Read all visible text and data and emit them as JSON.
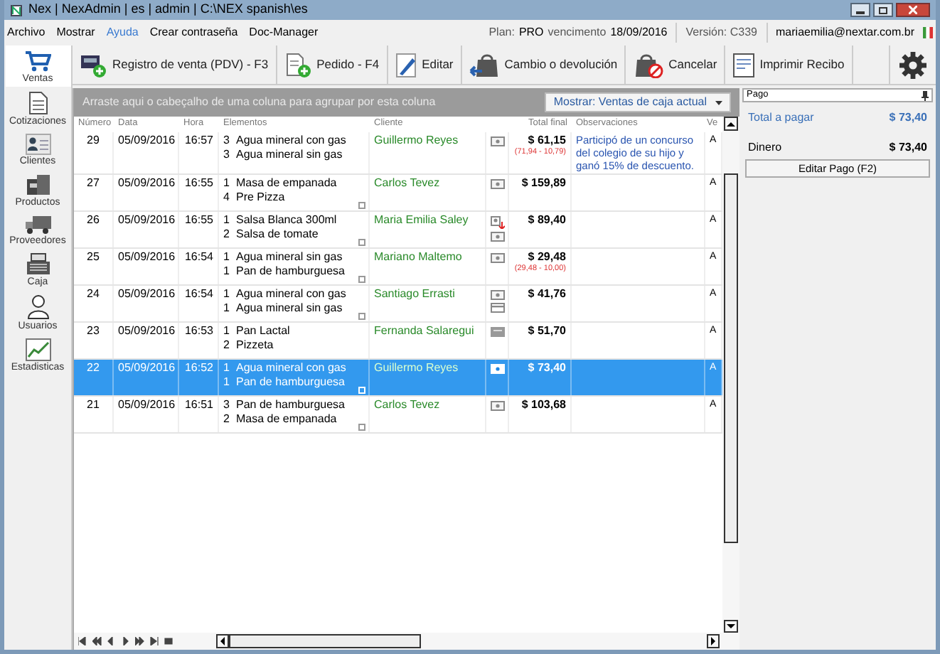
{
  "window": {
    "title": "Nex | NexAdmin | es | admin | C:\\NEX spanish\\es"
  },
  "menu": [
    {
      "label": "Archivo",
      "highlighted": false
    },
    {
      "label": "Mostrar",
      "highlighted": false
    },
    {
      "label": "Ayuda",
      "highlighted": true
    },
    {
      "label": "Crear contraseña",
      "highlighted": false
    },
    {
      "label": "Doc-Manager",
      "highlighted": false
    }
  ],
  "account": {
    "plan_label": "Plan:",
    "plan": "PRO",
    "expiry_label": "vencimento",
    "expiry": "18/09/2016",
    "version": "Versión: C339",
    "email": "mariaemilia@nextar.com.br"
  },
  "sidebar": {
    "items": [
      {
        "label": "Ventas",
        "selected": true
      },
      {
        "label": "Cotizaciones",
        "selected": false
      },
      {
        "label": "Clientes",
        "selected": false
      },
      {
        "label": "Productos",
        "selected": false
      },
      {
        "label": "Proveedores",
        "selected": false
      },
      {
        "label": "Caja",
        "selected": false
      },
      {
        "label": "Usuarios",
        "selected": false
      },
      {
        "label": "Estadisticas",
        "selected": false
      }
    ]
  },
  "toolbar": [
    {
      "label": "Registro de venta (PDV) - F3"
    },
    {
      "label": "Pedido - F4"
    },
    {
      "label": "Editar"
    },
    {
      "label": "Cambio o devolución"
    },
    {
      "label": "Cancelar"
    },
    {
      "label": "Imprimir Recibo"
    }
  ],
  "group_panel": {
    "hint": "Arraste aqui o cabeçalho de uma coluna para agrupar por esta coluna",
    "filter": "Mostrar: Ventas de caja actual"
  },
  "table": {
    "columns": [
      "Número",
      "Data",
      "Hora",
      "Elementos",
      "Cliente",
      "Total final",
      "Observaciones",
      "Ve"
    ],
    "rows": [
      {
        "number": "29",
        "date": "05/09/2016",
        "time": "16:57",
        "items": [
          {
            "qty": "3",
            "name": "Agua mineral con gas"
          },
          {
            "qty": "3",
            "name": "Agua mineral sin gas"
          }
        ],
        "expandable": false,
        "client": "Guillermo Reyes",
        "payments": [
          {
            "kind": "cash"
          }
        ],
        "total": "$ 61,15",
        "detail": "(71,94 - 10,79)",
        "observation": "Participó de un concurso del colegio de su hijo y ganó 15% de descuento.",
        "column_8": "A",
        "selected": false
      },
      {
        "number": "27",
        "date": "05/09/2016",
        "time": "16:55",
        "items": [
          {
            "qty": "1",
            "name": "Masa de empanada"
          },
          {
            "qty": "4",
            "name": "Pre Pizza"
          }
        ],
        "expandable": true,
        "client": "Carlos Tevez",
        "payments": [
          {
            "kind": "cash"
          }
        ],
        "total": "$ 159,89",
        "column_8": "A",
        "selected": false
      },
      {
        "number": "26",
        "date": "05/09/2016",
        "time": "16:55",
        "items": [
          {
            "qty": "1",
            "name": "Salsa Blanca 300ml"
          },
          {
            "qty": "2",
            "name": "Salsa de tomate"
          }
        ],
        "expandable": true,
        "client": "Maria Emilia Saley",
        "payments": [
          {
            "kind": "account"
          },
          {
            "kind": "cash"
          }
        ],
        "total": "$ 89,40",
        "column_8": "A",
        "selected": false
      },
      {
        "number": "25",
        "date": "05/09/2016",
        "time": "16:54",
        "items": [
          {
            "qty": "1",
            "name": "Agua mineral sin gas"
          },
          {
            "qty": "1",
            "name": "Pan de hamburguesa"
          }
        ],
        "expandable": true,
        "client": "Mariano Maltemo",
        "payments": [
          {
            "kind": "cash"
          }
        ],
        "total": "$ 29,48",
        "detail": "(29,48 - 10,00)",
        "column_8": "A",
        "selected": false
      },
      {
        "number": "24",
        "date": "05/09/2016",
        "time": "16:54",
        "items": [
          {
            "qty": "1",
            "name": "Agua mineral con gas"
          },
          {
            "qty": "1",
            "name": "Agua mineral sin gas"
          }
        ],
        "expandable": true,
        "client": "Santiago Errasti",
        "payments": [
          {
            "kind": "cash"
          },
          {
            "kind": "card"
          }
        ],
        "total": "$ 41,76",
        "column_8": "A",
        "selected": false
      },
      {
        "number": "23",
        "date": "05/09/2016",
        "time": "16:53",
        "items": [
          {
            "qty": "1",
            "name": "Pan Lactal"
          },
          {
            "qty": "2",
            "name": "Pizzeta"
          }
        ],
        "expandable": false,
        "client": "Fernanda Salaregui",
        "payments": [
          {
            "kind": "voucher"
          }
        ],
        "total": "$ 51,70",
        "column_8": "A",
        "selected": false
      },
      {
        "number": "22",
        "date": "05/09/2016",
        "time": "16:52",
        "items": [
          {
            "qty": "1",
            "name": "Agua mineral con gas"
          },
          {
            "qty": "1",
            "name": "Pan de hamburguesa"
          }
        ],
        "expandable": true,
        "client": "Guillermo Reyes",
        "payments": [
          {
            "kind": "cash"
          }
        ],
        "total": "$ 73,40",
        "column_8": "A",
        "selected": true
      },
      {
        "number": "21",
        "date": "05/09/2016",
        "time": "16:51",
        "items": [
          {
            "qty": "3",
            "name": "Pan de hamburguesa"
          },
          {
            "qty": "2",
            "name": "Masa de empanada"
          }
        ],
        "expandable": true,
        "client": "Carlos Tevez",
        "payments": [
          {
            "kind": "cash"
          }
        ],
        "total": "$ 103,68",
        "column_8": "A",
        "selected": false
      }
    ]
  },
  "payment_panel": {
    "title": "Pago",
    "total_label": "Total a pagar",
    "total": "$ 73,40",
    "cash_label": "Dinero",
    "cash": "$ 73,40",
    "button": "Editar Pago (F2)"
  }
}
